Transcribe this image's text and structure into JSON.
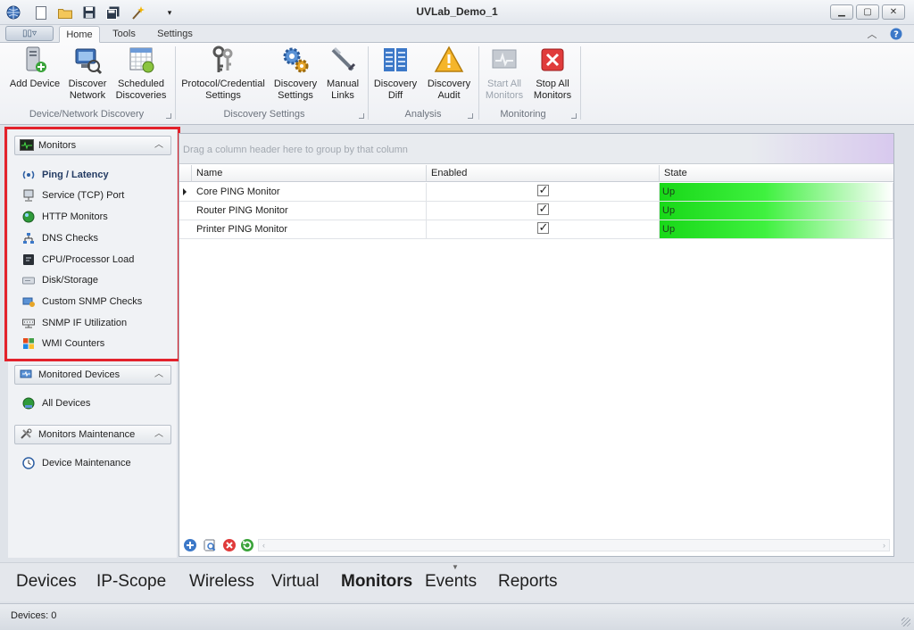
{
  "window": {
    "title": "UVLab_Demo_1",
    "controls": [
      "minimize-icon",
      "maximize-icon",
      "close-icon"
    ]
  },
  "quick_access": [
    "globe-icon",
    "new-document-icon",
    "open-folder-icon",
    "save-icon",
    "save-all-icon",
    "wizard-icon",
    "customize-dropdown-icon"
  ],
  "ribbon_tabs": [
    {
      "label": "Home",
      "active": true
    },
    {
      "label": "Tools",
      "active": false
    },
    {
      "label": "Settings",
      "active": false
    }
  ],
  "ribbon_groups": [
    {
      "label": "Device/Network Discovery",
      "buttons": [
        {
          "line1": "Add Device",
          "line2": "",
          "icon": "add-device-icon"
        },
        {
          "line1": "Discover",
          "line2": "Network",
          "icon": "discover-network-icon"
        },
        {
          "line1": "Scheduled",
          "line2": "Discoveries",
          "icon": "scheduled-discoveries-icon"
        }
      ]
    },
    {
      "label": "Discovery Settings",
      "buttons": [
        {
          "line1": "Protocol/Credential",
          "line2": "Settings",
          "icon": "keys-icon"
        },
        {
          "line1": "Discovery",
          "line2": "Settings",
          "icon": "gears-icon"
        },
        {
          "line1": "Manual",
          "line2": "Links",
          "icon": "manual-links-icon"
        }
      ]
    },
    {
      "label": "Analysis",
      "buttons": [
        {
          "line1": "Discovery",
          "line2": "Diff",
          "icon": "discovery-diff-icon"
        },
        {
          "line1": "Discovery",
          "line2": "Audit",
          "icon": "warning-icon"
        }
      ]
    },
    {
      "label": "Monitoring",
      "buttons": [
        {
          "line1": "Start All",
          "line2": "Monitors",
          "icon": "start-monitors-icon",
          "disabled": true
        },
        {
          "line1": "Stop All",
          "line2": "Monitors",
          "icon": "stop-monitors-icon"
        }
      ]
    }
  ],
  "nav": {
    "monitors": {
      "header": "Monitors",
      "icon": "monitor-pulse-icon",
      "items": [
        {
          "label": "Ping / Latency",
          "icon": "ping-icon",
          "active": true
        },
        {
          "label": "Service (TCP) Port",
          "icon": "tcp-port-icon"
        },
        {
          "label": "HTTP Monitors",
          "icon": "http-globe-icon"
        },
        {
          "label": "DNS Checks",
          "icon": "dns-icon"
        },
        {
          "label": "CPU/Processor Load",
          "icon": "cpu-icon"
        },
        {
          "label": "Disk/Storage",
          "icon": "disk-icon"
        },
        {
          "label": "Custom SNMP Checks",
          "icon": "snmp-icon"
        },
        {
          "label": "SNMP IF Utilization",
          "icon": "snmp-if-icon"
        },
        {
          "label": "WMI Counters",
          "icon": "windows-icon"
        }
      ]
    },
    "monitored_devices": {
      "header": "Monitored Devices",
      "icon": "monitored-devices-icon",
      "items": [
        {
          "label": "All Devices",
          "icon": "all-devices-icon"
        }
      ]
    },
    "monitors_maintenance": {
      "header": "Monitors Maintenance",
      "icon": "tools-icon",
      "items": [
        {
          "label": "Device Maintenance",
          "icon": "clock-icon"
        }
      ]
    }
  },
  "grid": {
    "group_hint": "Drag a column header here to group by that column",
    "columns": [
      "Name",
      "Enabled",
      "State"
    ],
    "rows": [
      {
        "name": "Core PING Monitor",
        "enabled": true,
        "state": "Up",
        "current": true
      },
      {
        "name": "Router PING Monitor",
        "enabled": true,
        "state": "Up",
        "current": false
      },
      {
        "name": "Printer PING Monitor",
        "enabled": true,
        "state": "Up",
        "current": false
      }
    ],
    "navigator": [
      "add-icon",
      "edit-icon",
      "delete-icon",
      "refresh-icon"
    ]
  },
  "bottom_nav": [
    {
      "label": "Devices",
      "active": false
    },
    {
      "label": "IP-Scope",
      "active": false
    },
    {
      "label": "Wireless",
      "active": false
    },
    {
      "label": "Virtual",
      "active": false
    },
    {
      "label": "Monitors",
      "active": true
    },
    {
      "label": "Events",
      "active": false
    },
    {
      "label": "Reports",
      "active": false
    }
  ],
  "status_bar": {
    "text": "Devices: 0"
  },
  "colors": {
    "state_up": "#18d818",
    "highlight_box": "#e3222c",
    "ribbon_bg": "#fbfbfc"
  }
}
